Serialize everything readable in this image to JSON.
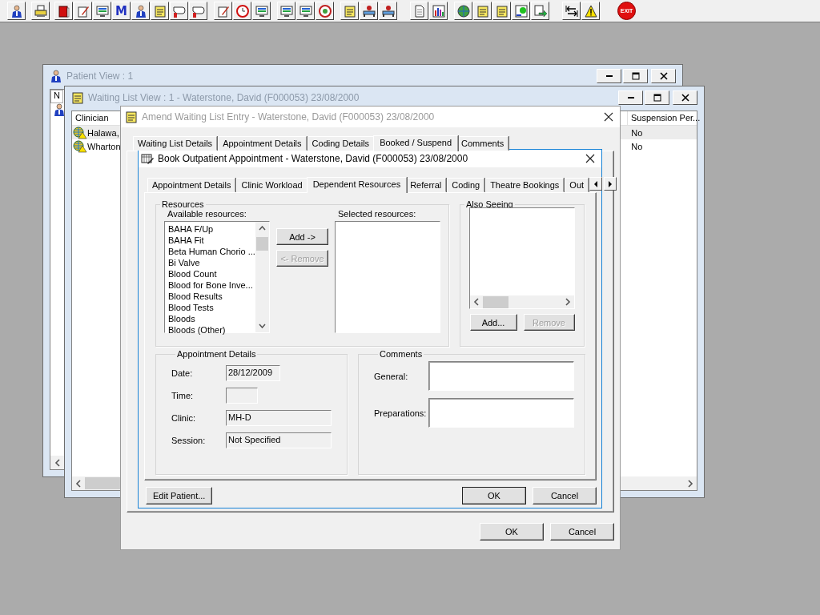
{
  "toolbar": {
    "letter": "M",
    "exit": "EXIT"
  },
  "patient_view": {
    "title": "Patient View : 1",
    "column_1": "N"
  },
  "waiting_list_view": {
    "title": "Waiting List View :  1 - Waterstone, David (F000053) 23/08/2000",
    "columns": [
      "Clinician",
      "Suspension Per..."
    ],
    "rows": [
      {
        "clinician": "Halawa,",
        "suspension": "No",
        "selected": true
      },
      {
        "clinician": "Wharton",
        "suspension": "No",
        "selected": false
      }
    ]
  },
  "amend_entry": {
    "title": "Amend Waiting List Entry - Waterstone, David (F000053) 23/08/2000",
    "tabs": [
      {
        "label": "Waiting List Details",
        "selected": false
      },
      {
        "label": "Appointment Details",
        "selected": false
      },
      {
        "label": "Coding Details",
        "selected": false
      },
      {
        "label": "Booked / Suspend",
        "selected": true
      },
      {
        "label": "Comments",
        "selected": false
      }
    ],
    "ok": "OK",
    "cancel": "Cancel"
  },
  "book_appointment": {
    "title": "Book Outpatient Appointment - Waterstone, David (F000053) 23/08/2000",
    "tabs": [
      {
        "label": "Appointment Details",
        "selected": false
      },
      {
        "label": "Clinic Workload",
        "selected": false
      },
      {
        "label": "Dependent Resources",
        "selected": true
      },
      {
        "label": "Referral",
        "selected": false
      },
      {
        "label": "Coding",
        "selected": false
      },
      {
        "label": "Theatre Bookings",
        "selected": false
      },
      {
        "label": "Out",
        "selected": false
      }
    ],
    "resources": {
      "legend": "Resources",
      "available_label": "Available resources:",
      "selected_label": "Selected resources:",
      "available": [
        "BAHA F/Up",
        "BAHA Fit",
        "Beta Human Chorio ...",
        "Bi Valve",
        "Blood Count",
        "Blood for Bone Inve...",
        "Blood Results",
        "Blood Tests",
        "Bloods",
        "Bloods (Other)"
      ],
      "add": {
        "label": "Add ->",
        "disabled": false
      },
      "remove": {
        "label": "<- Remove",
        "disabled": true
      }
    },
    "also_seeing": {
      "legend": "Also Seeing",
      "add": {
        "label": "Add...",
        "disabled": false
      },
      "remove": {
        "label": "Remove",
        "disabled": true
      }
    },
    "appointment_details": {
      "legend": "Appointment Details",
      "fields": [
        {
          "label": "Date:",
          "value": "28/12/2009",
          "kind": "date"
        },
        {
          "label": "Time:",
          "kind": "time"
        },
        {
          "label": "Clinic:",
          "value": "MH-D",
          "kind": "text"
        },
        {
          "label": "Session:",
          "value": "Not Specified",
          "kind": "text"
        }
      ]
    },
    "comments": {
      "legend": "Comments",
      "fields": [
        {
          "label": "General:"
        },
        {
          "label": "Preparations:"
        }
      ]
    },
    "edit_patient": "Edit Patient...",
    "ok": "OK",
    "cancel": "Cancel"
  }
}
